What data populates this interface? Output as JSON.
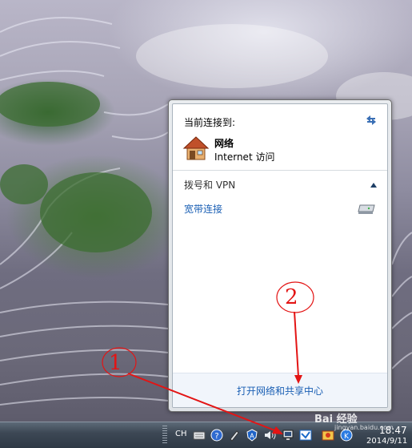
{
  "popup": {
    "section_title": "当前连接到:",
    "network_name": "网络",
    "network_access": "Internet 访问",
    "dialup_title": "拨号和 VPN",
    "connection_name": "宽带连接",
    "footer_link": "打开网络和共享中心"
  },
  "taskbar": {
    "language": "CH",
    "time": "18:47",
    "date": "2014/9/11"
  },
  "tray_icons": [
    "keyboard-icon",
    "help-icon",
    "pen-icon",
    "antivirus-icon",
    "volume-icon",
    "network-icon",
    "app-icon",
    "security-icon",
    "k-icon"
  ],
  "annotations": {
    "marker_1": "1",
    "marker_2": "2",
    "color": "#e31414"
  },
  "watermark": {
    "text": "Bai 经验",
    "url": "jingyan.baidu.com"
  }
}
